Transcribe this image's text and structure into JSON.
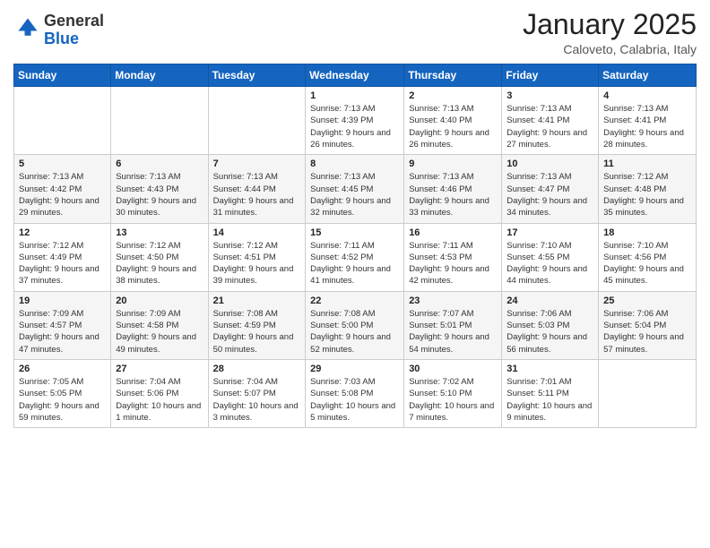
{
  "logo": {
    "general": "General",
    "blue": "Blue"
  },
  "header": {
    "month": "January 2025",
    "location": "Caloveto, Calabria, Italy"
  },
  "weekdays": [
    "Sunday",
    "Monday",
    "Tuesday",
    "Wednesday",
    "Thursday",
    "Friday",
    "Saturday"
  ],
  "weeks": [
    [
      {
        "day": "",
        "info": ""
      },
      {
        "day": "",
        "info": ""
      },
      {
        "day": "",
        "info": ""
      },
      {
        "day": "1",
        "info": "Sunrise: 7:13 AM\nSunset: 4:39 PM\nDaylight: 9 hours and 26 minutes."
      },
      {
        "day": "2",
        "info": "Sunrise: 7:13 AM\nSunset: 4:40 PM\nDaylight: 9 hours and 26 minutes."
      },
      {
        "day": "3",
        "info": "Sunrise: 7:13 AM\nSunset: 4:41 PM\nDaylight: 9 hours and 27 minutes."
      },
      {
        "day": "4",
        "info": "Sunrise: 7:13 AM\nSunset: 4:41 PM\nDaylight: 9 hours and 28 minutes."
      }
    ],
    [
      {
        "day": "5",
        "info": "Sunrise: 7:13 AM\nSunset: 4:42 PM\nDaylight: 9 hours and 29 minutes."
      },
      {
        "day": "6",
        "info": "Sunrise: 7:13 AM\nSunset: 4:43 PM\nDaylight: 9 hours and 30 minutes."
      },
      {
        "day": "7",
        "info": "Sunrise: 7:13 AM\nSunset: 4:44 PM\nDaylight: 9 hours and 31 minutes."
      },
      {
        "day": "8",
        "info": "Sunrise: 7:13 AM\nSunset: 4:45 PM\nDaylight: 9 hours and 32 minutes."
      },
      {
        "day": "9",
        "info": "Sunrise: 7:13 AM\nSunset: 4:46 PM\nDaylight: 9 hours and 33 minutes."
      },
      {
        "day": "10",
        "info": "Sunrise: 7:13 AM\nSunset: 4:47 PM\nDaylight: 9 hours and 34 minutes."
      },
      {
        "day": "11",
        "info": "Sunrise: 7:12 AM\nSunset: 4:48 PM\nDaylight: 9 hours and 35 minutes."
      }
    ],
    [
      {
        "day": "12",
        "info": "Sunrise: 7:12 AM\nSunset: 4:49 PM\nDaylight: 9 hours and 37 minutes."
      },
      {
        "day": "13",
        "info": "Sunrise: 7:12 AM\nSunset: 4:50 PM\nDaylight: 9 hours and 38 minutes."
      },
      {
        "day": "14",
        "info": "Sunrise: 7:12 AM\nSunset: 4:51 PM\nDaylight: 9 hours and 39 minutes."
      },
      {
        "day": "15",
        "info": "Sunrise: 7:11 AM\nSunset: 4:52 PM\nDaylight: 9 hours and 41 minutes."
      },
      {
        "day": "16",
        "info": "Sunrise: 7:11 AM\nSunset: 4:53 PM\nDaylight: 9 hours and 42 minutes."
      },
      {
        "day": "17",
        "info": "Sunrise: 7:10 AM\nSunset: 4:55 PM\nDaylight: 9 hours and 44 minutes."
      },
      {
        "day": "18",
        "info": "Sunrise: 7:10 AM\nSunset: 4:56 PM\nDaylight: 9 hours and 45 minutes."
      }
    ],
    [
      {
        "day": "19",
        "info": "Sunrise: 7:09 AM\nSunset: 4:57 PM\nDaylight: 9 hours and 47 minutes."
      },
      {
        "day": "20",
        "info": "Sunrise: 7:09 AM\nSunset: 4:58 PM\nDaylight: 9 hours and 49 minutes."
      },
      {
        "day": "21",
        "info": "Sunrise: 7:08 AM\nSunset: 4:59 PM\nDaylight: 9 hours and 50 minutes."
      },
      {
        "day": "22",
        "info": "Sunrise: 7:08 AM\nSunset: 5:00 PM\nDaylight: 9 hours and 52 minutes."
      },
      {
        "day": "23",
        "info": "Sunrise: 7:07 AM\nSunset: 5:01 PM\nDaylight: 9 hours and 54 minutes."
      },
      {
        "day": "24",
        "info": "Sunrise: 7:06 AM\nSunset: 5:03 PM\nDaylight: 9 hours and 56 minutes."
      },
      {
        "day": "25",
        "info": "Sunrise: 7:06 AM\nSunset: 5:04 PM\nDaylight: 9 hours and 57 minutes."
      }
    ],
    [
      {
        "day": "26",
        "info": "Sunrise: 7:05 AM\nSunset: 5:05 PM\nDaylight: 9 hours and 59 minutes."
      },
      {
        "day": "27",
        "info": "Sunrise: 7:04 AM\nSunset: 5:06 PM\nDaylight: 10 hours and 1 minute."
      },
      {
        "day": "28",
        "info": "Sunrise: 7:04 AM\nSunset: 5:07 PM\nDaylight: 10 hours and 3 minutes."
      },
      {
        "day": "29",
        "info": "Sunrise: 7:03 AM\nSunset: 5:08 PM\nDaylight: 10 hours and 5 minutes."
      },
      {
        "day": "30",
        "info": "Sunrise: 7:02 AM\nSunset: 5:10 PM\nDaylight: 10 hours and 7 minutes."
      },
      {
        "day": "31",
        "info": "Sunrise: 7:01 AM\nSunset: 5:11 PM\nDaylight: 10 hours and 9 minutes."
      },
      {
        "day": "",
        "info": ""
      }
    ]
  ]
}
